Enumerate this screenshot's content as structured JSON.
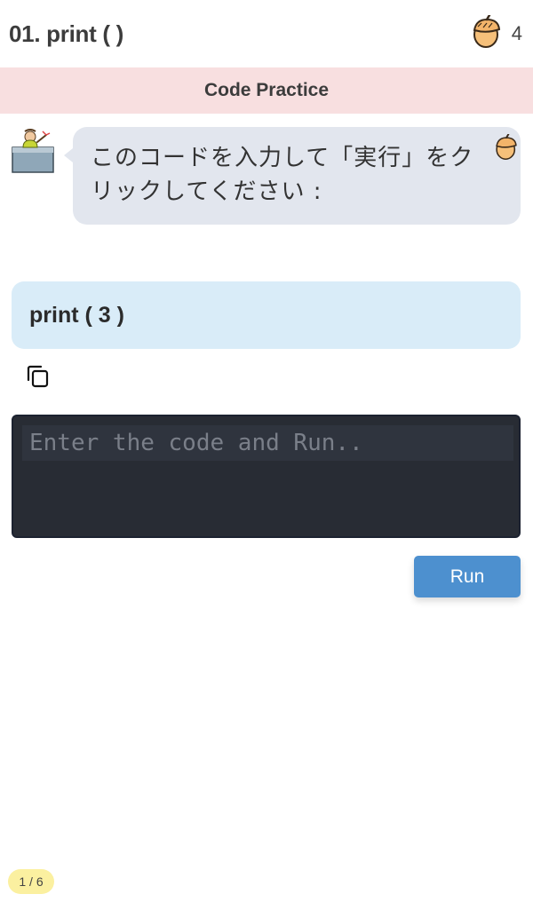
{
  "header": {
    "title": "01. print ( )",
    "acorn_icon": "acorn-icon",
    "acorn_count": "4"
  },
  "banner": {
    "label": "Code Practice"
  },
  "chat": {
    "avatar_icon": "teacher-avatar-icon",
    "message": "このコードを入力して「実行」をクリックしてください :",
    "bubble_icon": "acorn-icon"
  },
  "code_sample": {
    "code": "print ( 3 )",
    "copy_icon": "copy-icon"
  },
  "editor": {
    "placeholder": "Enter the code and Run..",
    "value": ""
  },
  "run_button": {
    "label": "Run"
  },
  "pagination": {
    "indicator": "1 / 6"
  },
  "colors": {
    "banner_bg": "#f8dfe0",
    "bubble_bg": "#e2e6ee",
    "code_bg": "#d9ecf8",
    "editor_bg": "#282c34",
    "run_button": "#4d90cf",
    "page_badge": "#fbf0a0"
  }
}
